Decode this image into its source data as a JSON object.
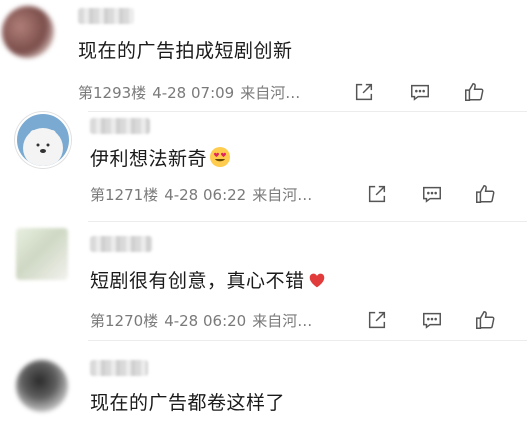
{
  "comments": [
    {
      "text": "现在的广告拍成短剧创新",
      "floor": "第1293楼",
      "time": "4-28 07:09",
      "source": "来自河…"
    },
    {
      "text": "伊利想法新奇",
      "emoji": "heart-eyes-emoji",
      "floor": "第1271楼",
      "time": "4-28 06:22",
      "source": "来自河…"
    },
    {
      "text": "短剧很有创意，真心不错",
      "emoji": "red-heart-emoji",
      "floor": "第1270楼",
      "time": "4-28 06:20",
      "source": "来自河…"
    },
    {
      "text": "现在的广告都卷这样了"
    }
  ],
  "icons": [
    "share-icon",
    "reply-icon",
    "like-icon"
  ],
  "colors": {
    "meta": "#7a7a7a",
    "text": "#1a1a1a",
    "heart": "#e23b3b"
  }
}
